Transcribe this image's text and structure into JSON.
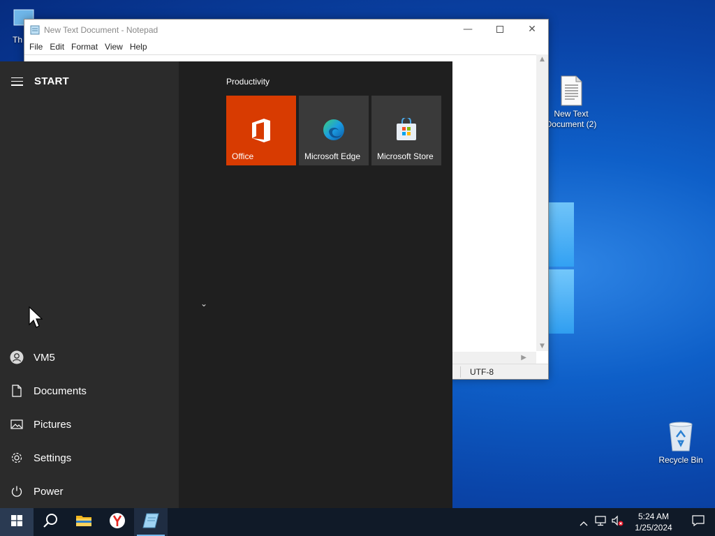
{
  "desktop": {
    "icons": [
      {
        "label": "New Text Document (2)"
      },
      {
        "label": "Recycle Bin"
      }
    ],
    "partial_icon_label": "Th"
  },
  "notepad": {
    "title": "New Text Document - Notepad",
    "menu": [
      "File",
      "Edit",
      "Format",
      "View",
      "Help"
    ],
    "status_encoding": "UTF-8"
  },
  "start_menu": {
    "title": "START",
    "left_items": [
      "VM5",
      "Documents",
      "Pictures",
      "Settings",
      "Power"
    ],
    "group_label": "Productivity",
    "tiles": [
      {
        "label": "Office",
        "color": "#d83b01"
      },
      {
        "label": "Microsoft Edge",
        "color": "#3a3a3a"
      },
      {
        "label": "Microsoft Store",
        "color": "#3a3a3a"
      }
    ]
  },
  "taskbar": {
    "time": "5:24 AM",
    "date": "1/25/2024"
  },
  "colors": {
    "taskbar": "#101a28",
    "start_left": "#2b2b2b",
    "start_bg": "#1f1f1f",
    "office_tile": "#d83b01"
  }
}
